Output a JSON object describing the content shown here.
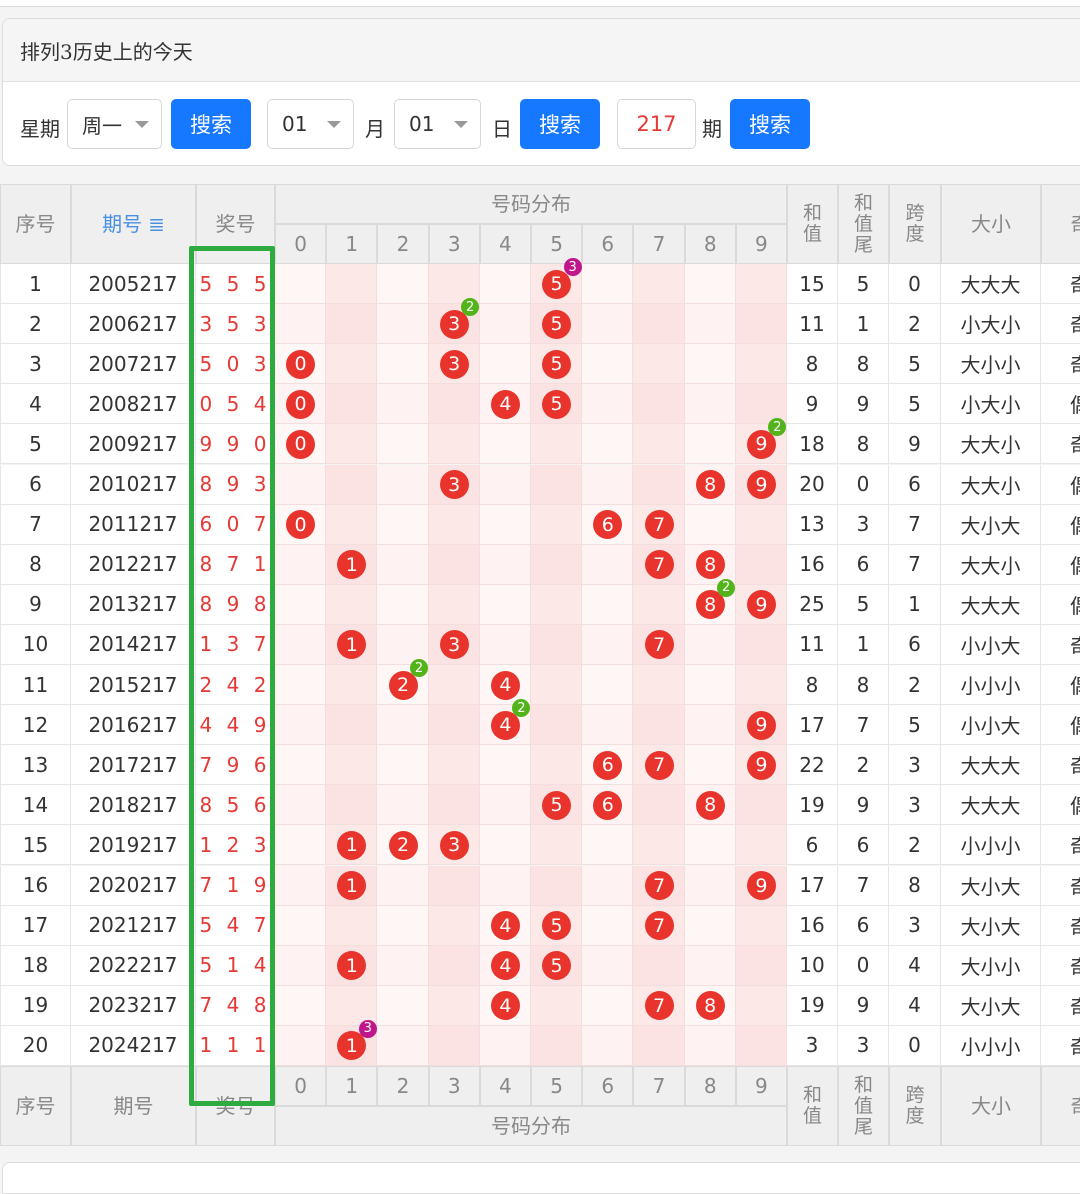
{
  "panel": {
    "title": "排列3历史上的今天",
    "week_label": "星期",
    "week_value": "周一",
    "search_label": "搜索",
    "month_value": "01",
    "month_label": "月",
    "day_value": "01",
    "day_label": "日",
    "issue_value": "217",
    "issue_label": "期"
  },
  "table": {
    "headers": {
      "seq": "序号",
      "issue": "期号",
      "prize": "奖号",
      "dist": "号码分布",
      "sum": "和值",
      "sum_tail": "和值尾",
      "span": "跨度",
      "size": "大小",
      "odd": "奇"
    },
    "digits": [
      "0",
      "1",
      "2",
      "3",
      "4",
      "5",
      "6",
      "7",
      "8",
      "9"
    ],
    "rows": [
      {
        "seq": "1",
        "issue": "2005217",
        "prize": "5 5 5",
        "balls": [
          5
        ],
        "badges": [
          {
            "d": 5,
            "n": "3"
          }
        ],
        "sum": "15",
        "tail": "5",
        "span": "0",
        "size": "大大大",
        "odd": "奇"
      },
      {
        "seq": "2",
        "issue": "2006217",
        "prize": "3 5 3",
        "balls": [
          3,
          5
        ],
        "badges": [
          {
            "d": 3,
            "n": "2"
          }
        ],
        "sum": "11",
        "tail": "1",
        "span": "2",
        "size": "小大小",
        "odd": "奇"
      },
      {
        "seq": "3",
        "issue": "2007217",
        "prize": "5 0 3",
        "balls": [
          0,
          3,
          5
        ],
        "badges": [],
        "sum": "8",
        "tail": "8",
        "span": "5",
        "size": "大小小",
        "odd": "奇"
      },
      {
        "seq": "4",
        "issue": "2008217",
        "prize": "0 5 4",
        "balls": [
          0,
          4,
          5
        ],
        "badges": [],
        "sum": "9",
        "tail": "9",
        "span": "5",
        "size": "小大小",
        "odd": "偶"
      },
      {
        "seq": "5",
        "issue": "2009217",
        "prize": "9 9 0",
        "balls": [
          0,
          9
        ],
        "badges": [
          {
            "d": 9,
            "n": "2"
          }
        ],
        "sum": "18",
        "tail": "8",
        "span": "9",
        "size": "大大小",
        "odd": "奇"
      },
      {
        "seq": "6",
        "issue": "2010217",
        "prize": "8 9 3",
        "balls": [
          3,
          8,
          9
        ],
        "badges": [],
        "sum": "20",
        "tail": "0",
        "span": "6",
        "size": "大大小",
        "odd": "偶"
      },
      {
        "seq": "7",
        "issue": "2011217",
        "prize": "6 0 7",
        "balls": [
          0,
          6,
          7
        ],
        "badges": [],
        "sum": "13",
        "tail": "3",
        "span": "7",
        "size": "大小大",
        "odd": "偶"
      },
      {
        "seq": "8",
        "issue": "2012217",
        "prize": "8 7 1",
        "balls": [
          1,
          7,
          8
        ],
        "badges": [],
        "sum": "16",
        "tail": "6",
        "span": "7",
        "size": "大大小",
        "odd": "偶"
      },
      {
        "seq": "9",
        "issue": "2013217",
        "prize": "8 9 8",
        "balls": [
          8,
          9
        ],
        "badges": [
          {
            "d": 8,
            "n": "2"
          }
        ],
        "sum": "25",
        "tail": "5",
        "span": "1",
        "size": "大大大",
        "odd": "偶"
      },
      {
        "seq": "10",
        "issue": "2014217",
        "prize": "1 3 7",
        "balls": [
          1,
          3,
          7
        ],
        "badges": [],
        "sum": "11",
        "tail": "1",
        "span": "6",
        "size": "小小大",
        "odd": "奇"
      },
      {
        "seq": "11",
        "issue": "2015217",
        "prize": "2 4 2",
        "balls": [
          2,
          4
        ],
        "badges": [
          {
            "d": 2,
            "n": "2"
          }
        ],
        "sum": "8",
        "tail": "8",
        "span": "2",
        "size": "小小小",
        "odd": "偶"
      },
      {
        "seq": "12",
        "issue": "2016217",
        "prize": "4 4 9",
        "balls": [
          4,
          9
        ],
        "badges": [
          {
            "d": 4,
            "n": "2"
          }
        ],
        "sum": "17",
        "tail": "7",
        "span": "5",
        "size": "小小大",
        "odd": "偶"
      },
      {
        "seq": "13",
        "issue": "2017217",
        "prize": "7 9 6",
        "balls": [
          6,
          7,
          9
        ],
        "badges": [],
        "sum": "22",
        "tail": "2",
        "span": "3",
        "size": "大大大",
        "odd": "奇"
      },
      {
        "seq": "14",
        "issue": "2018217",
        "prize": "8 5 6",
        "balls": [
          5,
          6,
          8
        ],
        "badges": [],
        "sum": "19",
        "tail": "9",
        "span": "3",
        "size": "大大大",
        "odd": "偶"
      },
      {
        "seq": "15",
        "issue": "2019217",
        "prize": "1 2 3",
        "balls": [
          1,
          2,
          3
        ],
        "badges": [],
        "sum": "6",
        "tail": "6",
        "span": "2",
        "size": "小小小",
        "odd": "奇"
      },
      {
        "seq": "16",
        "issue": "2020217",
        "prize": "7 1 9",
        "balls": [
          1,
          7,
          9
        ],
        "badges": [],
        "sum": "17",
        "tail": "7",
        "span": "8",
        "size": "大小大",
        "odd": "奇"
      },
      {
        "seq": "17",
        "issue": "2021217",
        "prize": "5 4 7",
        "balls": [
          4,
          5,
          7
        ],
        "badges": [],
        "sum": "16",
        "tail": "6",
        "span": "3",
        "size": "大小大",
        "odd": "奇"
      },
      {
        "seq": "18",
        "issue": "2022217",
        "prize": "5 1 4",
        "balls": [
          1,
          4,
          5
        ],
        "badges": [],
        "sum": "10",
        "tail": "0",
        "span": "4",
        "size": "大小小",
        "odd": "奇"
      },
      {
        "seq": "19",
        "issue": "2023217",
        "prize": "7 4 8",
        "balls": [
          4,
          7,
          8
        ],
        "badges": [],
        "sum": "19",
        "tail": "9",
        "span": "4",
        "size": "大小大",
        "odd": "奇"
      },
      {
        "seq": "20",
        "issue": "2024217",
        "prize": "1 1 1",
        "balls": [
          1
        ],
        "badges": [
          {
            "d": 1,
            "n": "3"
          }
        ],
        "sum": "3",
        "tail": "3",
        "span": "0",
        "size": "小小小",
        "odd": "奇"
      }
    ]
  },
  "colors": {
    "accent": "#1677ff",
    "ball": "#e8342c",
    "badge_2": "#52b41a",
    "badge_3": "#c0168c",
    "highlight_box": "#2eab3e",
    "stripe_a": "#fff6f6",
    "stripe_b": "#fde8e8"
  }
}
